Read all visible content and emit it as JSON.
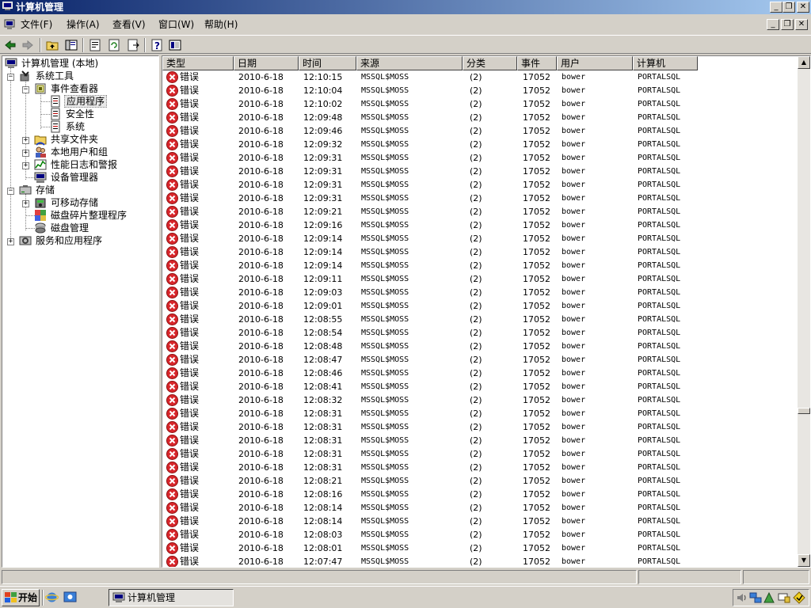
{
  "window": {
    "title": "计算机管理"
  },
  "menu": [
    "文件(F)",
    "操作(A)",
    "查看(V)",
    "窗口(W)",
    "帮助(H)"
  ],
  "toolbar": [
    "back-icon",
    "forward-icon",
    "up-folder-icon",
    "show-tree-icon",
    "properties-icon",
    "refresh-icon",
    "export-icon",
    "help-icon",
    "console-icon"
  ],
  "tree": [
    {
      "label": "计算机管理 (本地)",
      "icon": "computer-icon"
    },
    {
      "label": "系统工具",
      "icon": "tools-icon"
    },
    {
      "label": "事件查看器",
      "icon": "event-viewer-icon"
    },
    {
      "label": "应用程序",
      "icon": "log-icon",
      "selected": true
    },
    {
      "label": "安全性",
      "icon": "log-icon"
    },
    {
      "label": "系统",
      "icon": "log-icon"
    },
    {
      "label": "共享文件夹",
      "icon": "shared-folder-icon"
    },
    {
      "label": "本地用户和组",
      "icon": "users-icon"
    },
    {
      "label": "性能日志和警报",
      "icon": "perf-icon"
    },
    {
      "label": "设备管理器",
      "icon": "device-icon"
    },
    {
      "label": "存储",
      "icon": "storage-icon"
    },
    {
      "label": "可移动存储",
      "icon": "removable-icon"
    },
    {
      "label": "磁盘碎片整理程序",
      "icon": "defrag-icon"
    },
    {
      "label": "磁盘管理",
      "icon": "disk-icon"
    },
    {
      "label": "服务和应用程序",
      "icon": "services-icon"
    }
  ],
  "columns": [
    "类型",
    "日期",
    "时间",
    "来源",
    "分类",
    "事件",
    "用户",
    "计算机"
  ],
  "events": [
    {
      "type": "错误",
      "date": "2010-6-18",
      "time": "12:10:15",
      "source": "MSSQL$MOSS",
      "category": "(2)",
      "event": "17052",
      "user": "bower",
      "computer": "PORTALSQL"
    },
    {
      "type": "错误",
      "date": "2010-6-18",
      "time": "12:10:04",
      "source": "MSSQL$MOSS",
      "category": "(2)",
      "event": "17052",
      "user": "bower",
      "computer": "PORTALSQL"
    },
    {
      "type": "错误",
      "date": "2010-6-18",
      "time": "12:10:02",
      "source": "MSSQL$MOSS",
      "category": "(2)",
      "event": "17052",
      "user": "bower",
      "computer": "PORTALSQL"
    },
    {
      "type": "错误",
      "date": "2010-6-18",
      "time": "12:09:48",
      "source": "MSSQL$MOSS",
      "category": "(2)",
      "event": "17052",
      "user": "bower",
      "computer": "PORTALSQL"
    },
    {
      "type": "错误",
      "date": "2010-6-18",
      "time": "12:09:46",
      "source": "MSSQL$MOSS",
      "category": "(2)",
      "event": "17052",
      "user": "bower",
      "computer": "PORTALSQL"
    },
    {
      "type": "错误",
      "date": "2010-6-18",
      "time": "12:09:32",
      "source": "MSSQL$MOSS",
      "category": "(2)",
      "event": "17052",
      "user": "bower",
      "computer": "PORTALSQL"
    },
    {
      "type": "错误",
      "date": "2010-6-18",
      "time": "12:09:31",
      "source": "MSSQL$MOSS",
      "category": "(2)",
      "event": "17052",
      "user": "bower",
      "computer": "PORTALSQL"
    },
    {
      "type": "错误",
      "date": "2010-6-18",
      "time": "12:09:31",
      "source": "MSSQL$MOSS",
      "category": "(2)",
      "event": "17052",
      "user": "bower",
      "computer": "PORTALSQL"
    },
    {
      "type": "错误",
      "date": "2010-6-18",
      "time": "12:09:31",
      "source": "MSSQL$MOSS",
      "category": "(2)",
      "event": "17052",
      "user": "bower",
      "computer": "PORTALSQL"
    },
    {
      "type": "错误",
      "date": "2010-6-18",
      "time": "12:09:31",
      "source": "MSSQL$MOSS",
      "category": "(2)",
      "event": "17052",
      "user": "bower",
      "computer": "PORTALSQL"
    },
    {
      "type": "错误",
      "date": "2010-6-18",
      "time": "12:09:21",
      "source": "MSSQL$MOSS",
      "category": "(2)",
      "event": "17052",
      "user": "bower",
      "computer": "PORTALSQL"
    },
    {
      "type": "错误",
      "date": "2010-6-18",
      "time": "12:09:16",
      "source": "MSSQL$MOSS",
      "category": "(2)",
      "event": "17052",
      "user": "bower",
      "computer": "PORTALSQL"
    },
    {
      "type": "错误",
      "date": "2010-6-18",
      "time": "12:09:14",
      "source": "MSSQL$MOSS",
      "category": "(2)",
      "event": "17052",
      "user": "bower",
      "computer": "PORTALSQL"
    },
    {
      "type": "错误",
      "date": "2010-6-18",
      "time": "12:09:14",
      "source": "MSSQL$MOSS",
      "category": "(2)",
      "event": "17052",
      "user": "bower",
      "computer": "PORTALSQL"
    },
    {
      "type": "错误",
      "date": "2010-6-18",
      "time": "12:09:14",
      "source": "MSSQL$MOSS",
      "category": "(2)",
      "event": "17052",
      "user": "bower",
      "computer": "PORTALSQL"
    },
    {
      "type": "错误",
      "date": "2010-6-18",
      "time": "12:09:11",
      "source": "MSSQL$MOSS",
      "category": "(2)",
      "event": "17052",
      "user": "bower",
      "computer": "PORTALSQL"
    },
    {
      "type": "错误",
      "date": "2010-6-18",
      "time": "12:09:03",
      "source": "MSSQL$MOSS",
      "category": "(2)",
      "event": "17052",
      "user": "bower",
      "computer": "PORTALSQL"
    },
    {
      "type": "错误",
      "date": "2010-6-18",
      "time": "12:09:01",
      "source": "MSSQL$MOSS",
      "category": "(2)",
      "event": "17052",
      "user": "bower",
      "computer": "PORTALSQL"
    },
    {
      "type": "错误",
      "date": "2010-6-18",
      "time": "12:08:55",
      "source": "MSSQL$MOSS",
      "category": "(2)",
      "event": "17052",
      "user": "bower",
      "computer": "PORTALSQL"
    },
    {
      "type": "错误",
      "date": "2010-6-18",
      "time": "12:08:54",
      "source": "MSSQL$MOSS",
      "category": "(2)",
      "event": "17052",
      "user": "bower",
      "computer": "PORTALSQL"
    },
    {
      "type": "错误",
      "date": "2010-6-18",
      "time": "12:08:48",
      "source": "MSSQL$MOSS",
      "category": "(2)",
      "event": "17052",
      "user": "bower",
      "computer": "PORTALSQL"
    },
    {
      "type": "错误",
      "date": "2010-6-18",
      "time": "12:08:47",
      "source": "MSSQL$MOSS",
      "category": "(2)",
      "event": "17052",
      "user": "bower",
      "computer": "PORTALSQL"
    },
    {
      "type": "错误",
      "date": "2010-6-18",
      "time": "12:08:46",
      "source": "MSSQL$MOSS",
      "category": "(2)",
      "event": "17052",
      "user": "bower",
      "computer": "PORTALSQL"
    },
    {
      "type": "错误",
      "date": "2010-6-18",
      "time": "12:08:41",
      "source": "MSSQL$MOSS",
      "category": "(2)",
      "event": "17052",
      "user": "bower",
      "computer": "PORTALSQL"
    },
    {
      "type": "错误",
      "date": "2010-6-18",
      "time": "12:08:32",
      "source": "MSSQL$MOSS",
      "category": "(2)",
      "event": "17052",
      "user": "bower",
      "computer": "PORTALSQL"
    },
    {
      "type": "错误",
      "date": "2010-6-18",
      "time": "12:08:31",
      "source": "MSSQL$MOSS",
      "category": "(2)",
      "event": "17052",
      "user": "bower",
      "computer": "PORTALSQL"
    },
    {
      "type": "错误",
      "date": "2010-6-18",
      "time": "12:08:31",
      "source": "MSSQL$MOSS",
      "category": "(2)",
      "event": "17052",
      "user": "bower",
      "computer": "PORTALSQL"
    },
    {
      "type": "错误",
      "date": "2010-6-18",
      "time": "12:08:31",
      "source": "MSSQL$MOSS",
      "category": "(2)",
      "event": "17052",
      "user": "bower",
      "computer": "PORTALSQL"
    },
    {
      "type": "错误",
      "date": "2010-6-18",
      "time": "12:08:31",
      "source": "MSSQL$MOSS",
      "category": "(2)",
      "event": "17052",
      "user": "bower",
      "computer": "PORTALSQL"
    },
    {
      "type": "错误",
      "date": "2010-6-18",
      "time": "12:08:31",
      "source": "MSSQL$MOSS",
      "category": "(2)",
      "event": "17052",
      "user": "bower",
      "computer": "PORTALSQL"
    },
    {
      "type": "错误",
      "date": "2010-6-18",
      "time": "12:08:21",
      "source": "MSSQL$MOSS",
      "category": "(2)",
      "event": "17052",
      "user": "bower",
      "computer": "PORTALSQL"
    },
    {
      "type": "错误",
      "date": "2010-6-18",
      "time": "12:08:16",
      "source": "MSSQL$MOSS",
      "category": "(2)",
      "event": "17052",
      "user": "bower",
      "computer": "PORTALSQL"
    },
    {
      "type": "错误",
      "date": "2010-6-18",
      "time": "12:08:14",
      "source": "MSSQL$MOSS",
      "category": "(2)",
      "event": "17052",
      "user": "bower",
      "computer": "PORTALSQL"
    },
    {
      "type": "错误",
      "date": "2010-6-18",
      "time": "12:08:14",
      "source": "MSSQL$MOSS",
      "category": "(2)",
      "event": "17052",
      "user": "bower",
      "computer": "PORTALSQL"
    },
    {
      "type": "错误",
      "date": "2010-6-18",
      "time": "12:08:03",
      "source": "MSSQL$MOSS",
      "category": "(2)",
      "event": "17052",
      "user": "bower",
      "computer": "PORTALSQL"
    },
    {
      "type": "错误",
      "date": "2010-6-18",
      "time": "12:08:01",
      "source": "MSSQL$MOSS",
      "category": "(2)",
      "event": "17052",
      "user": "bower",
      "computer": "PORTALSQL"
    },
    {
      "type": "错误",
      "date": "2010-6-18",
      "time": "12:07:47",
      "source": "MSSQL$MOSS",
      "category": "(2)",
      "event": "17052",
      "user": "bower",
      "computer": "PORTALSQL"
    }
  ],
  "taskbar": {
    "start_label": "开始",
    "task_label": "计算机管理"
  },
  "colors": {
    "titlebar_start": "#0a246a",
    "titlebar_end": "#a6caf0",
    "error_red": "#d8262b",
    "face": "#d4d0c8"
  }
}
